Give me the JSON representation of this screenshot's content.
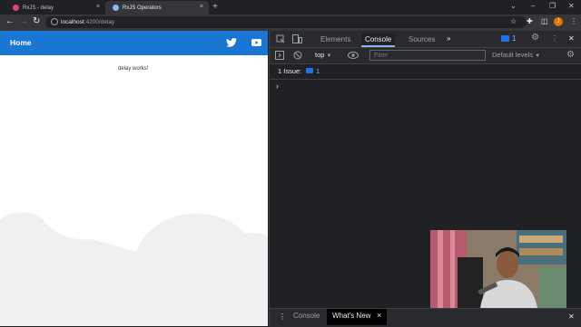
{
  "browser": {
    "tabs": [
      {
        "title": "RxJS - delay",
        "close": "×",
        "favicon_color": "#e83e8c"
      },
      {
        "title": "RxJS Operators",
        "close": "×",
        "favicon_color": "#8ab4f8"
      }
    ],
    "new_tab": "+",
    "window_controls": {
      "chevron": "⌄",
      "minimize": "–",
      "restore": "❐",
      "close": "✕"
    },
    "nav": {
      "back": "←",
      "forward": "→",
      "reload": "↻"
    },
    "address": {
      "host": "localhost",
      "path": ":4200/delay"
    },
    "toolbar_icons": {
      "star": "☆",
      "extensions": "✚",
      "sidebar": "◫",
      "profile": "J",
      "menu": "⋮"
    }
  },
  "app": {
    "brand": "Home",
    "message": "delay works!",
    "brand_color": "#1976d2"
  },
  "devtools": {
    "tabs": [
      "Elements",
      "Console",
      "Sources"
    ],
    "active_tab": "Console",
    "more": "»",
    "issues_badge": "1",
    "context": "top",
    "filter_placeholder": "Filter",
    "levels": "Default levels",
    "issues_text": "1 Issue:",
    "issues_count": "1",
    "prompt": "›",
    "drawer": {
      "menu": "⋮",
      "tabs": [
        "Console",
        "What's New"
      ],
      "close": "×",
      "drawer_close": "✕"
    }
  }
}
